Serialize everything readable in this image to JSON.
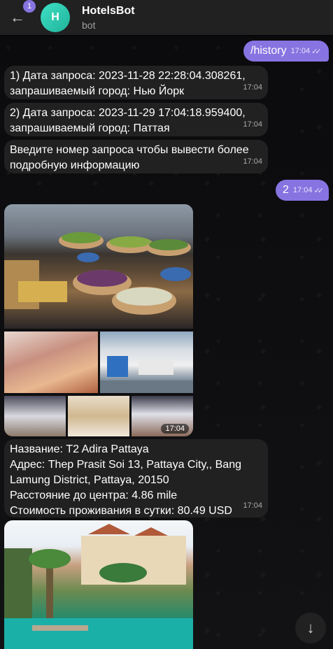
{
  "header": {
    "back_badge": "1",
    "avatar_letter": "H",
    "title": "HotelsBot",
    "subtitle": "bot"
  },
  "messages": {
    "history_cmd": {
      "text": "/history",
      "time": "17:04"
    },
    "req1": {
      "line1": "1) Дата запроса: 2023-11-28 22:28:04.308261,",
      "line2": "запрашиваемый город: Нью Йорк",
      "time": "17:04"
    },
    "req2": {
      "line1": "2) Дата запроса: 2023-11-29 17:04:18.959400,",
      "line2": "запрашиваемый город: Паттая",
      "time": "17:04"
    },
    "prompt": {
      "line1": "Введите номер запроса чтобы вывести более",
      "line2": "подробную информацию",
      "time": "17:04"
    },
    "answer": {
      "text": "2",
      "time": "17:04"
    },
    "album_time": "17:04",
    "hotel": {
      "line1": "Название: T2 Adira Pattaya",
      "line2": "Адрес: Thep Prasit Soi 13, Pattaya City,, Bang",
      "line3": "Lamung District, Pattaya, 20150",
      "line4": "Расстояние до центра: 4.86 mile",
      "line5": "Стоимость проживания в сутки: 80.49 USD",
      "time": "17:04"
    }
  },
  "colors": {
    "accent": "#8774e1",
    "bubble_in": "#212121",
    "header": "#212121"
  }
}
